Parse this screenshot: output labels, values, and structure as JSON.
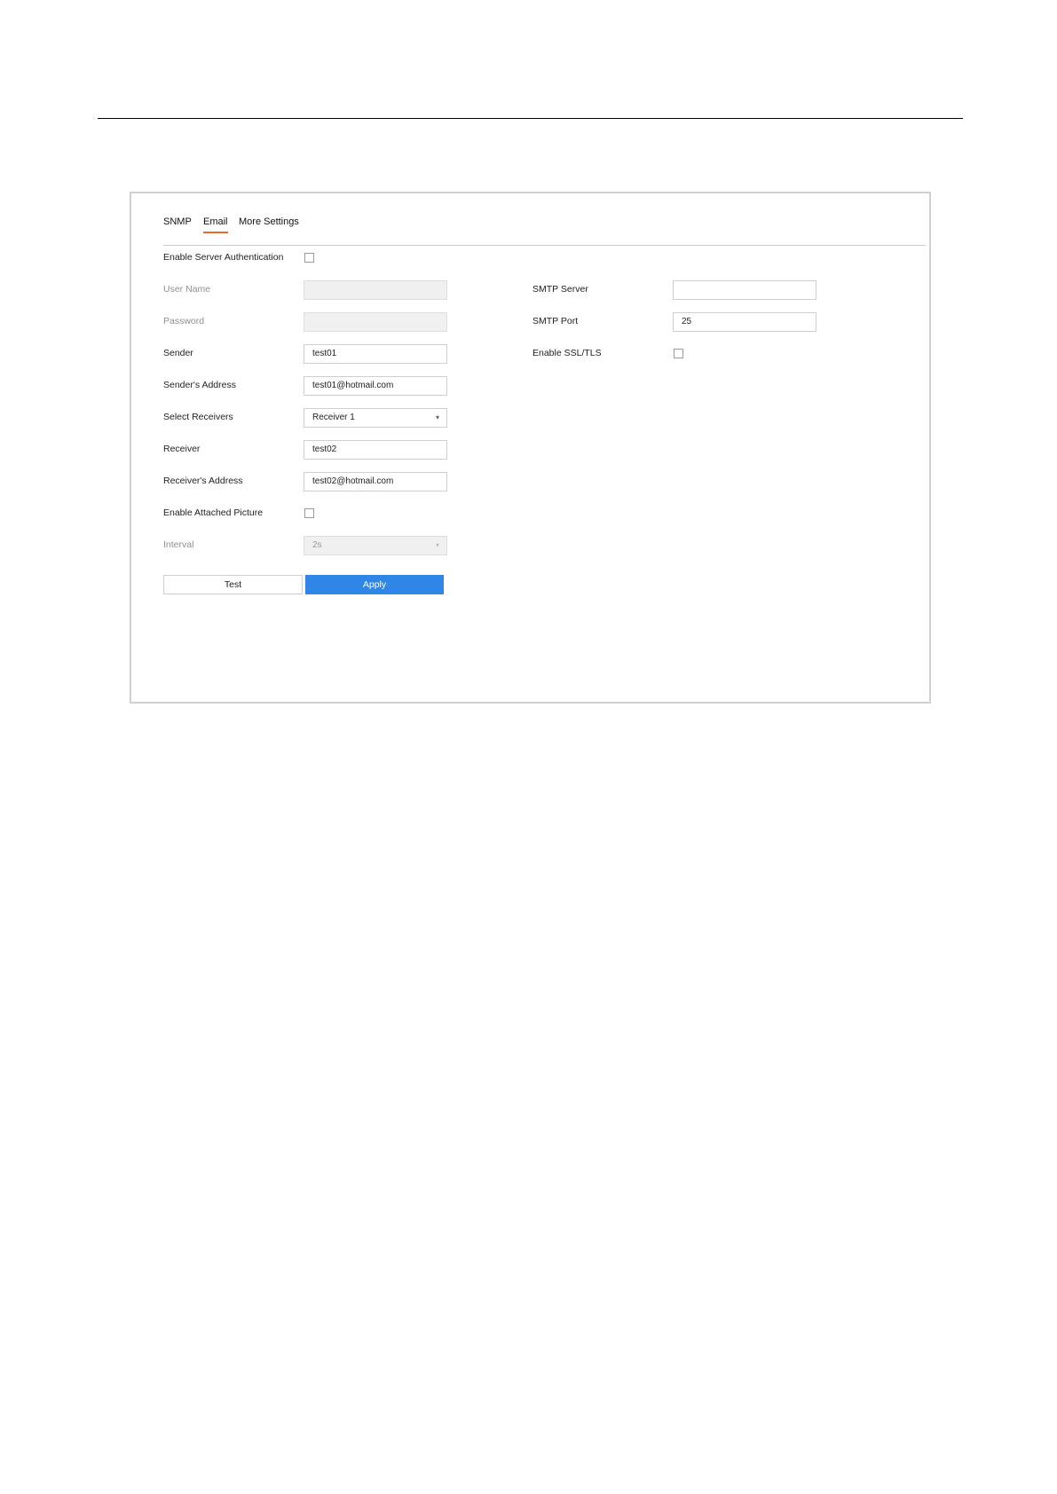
{
  "tabs": [
    {
      "label": "SNMP",
      "active": false
    },
    {
      "label": "Email",
      "active": true
    },
    {
      "label": "More Settings",
      "active": false
    }
  ],
  "left": {
    "enable_server_auth": {
      "label": "Enable Server Authentication",
      "checked": false
    },
    "user_name": {
      "label": "User Name",
      "value": "",
      "enabled": false
    },
    "password": {
      "label": "Password",
      "value": "",
      "enabled": false
    },
    "sender": {
      "label": "Sender",
      "value": "test01"
    },
    "senders_address": {
      "label": "Sender's Address",
      "value": "test01@hotmail.com"
    },
    "select_receivers": {
      "label": "Select Receivers",
      "value": "Receiver 1"
    },
    "receiver": {
      "label": "Receiver",
      "value": "test02"
    },
    "receivers_address": {
      "label": "Receiver's Address",
      "value": "test02@hotmail.com"
    },
    "enable_attached_picture": {
      "label": "Enable Attached Picture",
      "checked": false
    },
    "interval": {
      "label": "Interval",
      "value": "2s",
      "enabled": false
    }
  },
  "right": {
    "smtp_server": {
      "label": "SMTP Server",
      "value": ""
    },
    "smtp_port": {
      "label": "SMTP Port",
      "value": "25"
    },
    "enable_ssl_tls": {
      "label": "Enable SSL/TLS",
      "checked": false
    }
  },
  "buttons": {
    "test_label": "Test",
    "apply_label": "Apply"
  },
  "colors": {
    "accent": "#2f86e6",
    "active_tab_underline": "#e8692d"
  }
}
